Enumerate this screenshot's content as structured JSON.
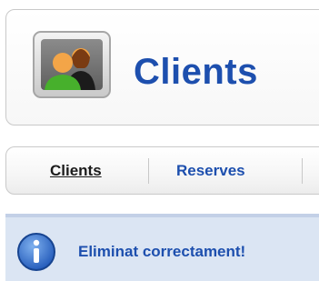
{
  "header": {
    "title": "Clients",
    "icon": "users-icon"
  },
  "tabs": [
    {
      "label": "Clients",
      "active": true
    },
    {
      "label": "Reserves",
      "active": false
    }
  ],
  "message": {
    "text": "Eliminat correctament!",
    "icon": "info-icon",
    "background": "#dbe5f3",
    "text_color": "#1d4fae"
  },
  "colors": {
    "accent": "#1d4fae"
  }
}
